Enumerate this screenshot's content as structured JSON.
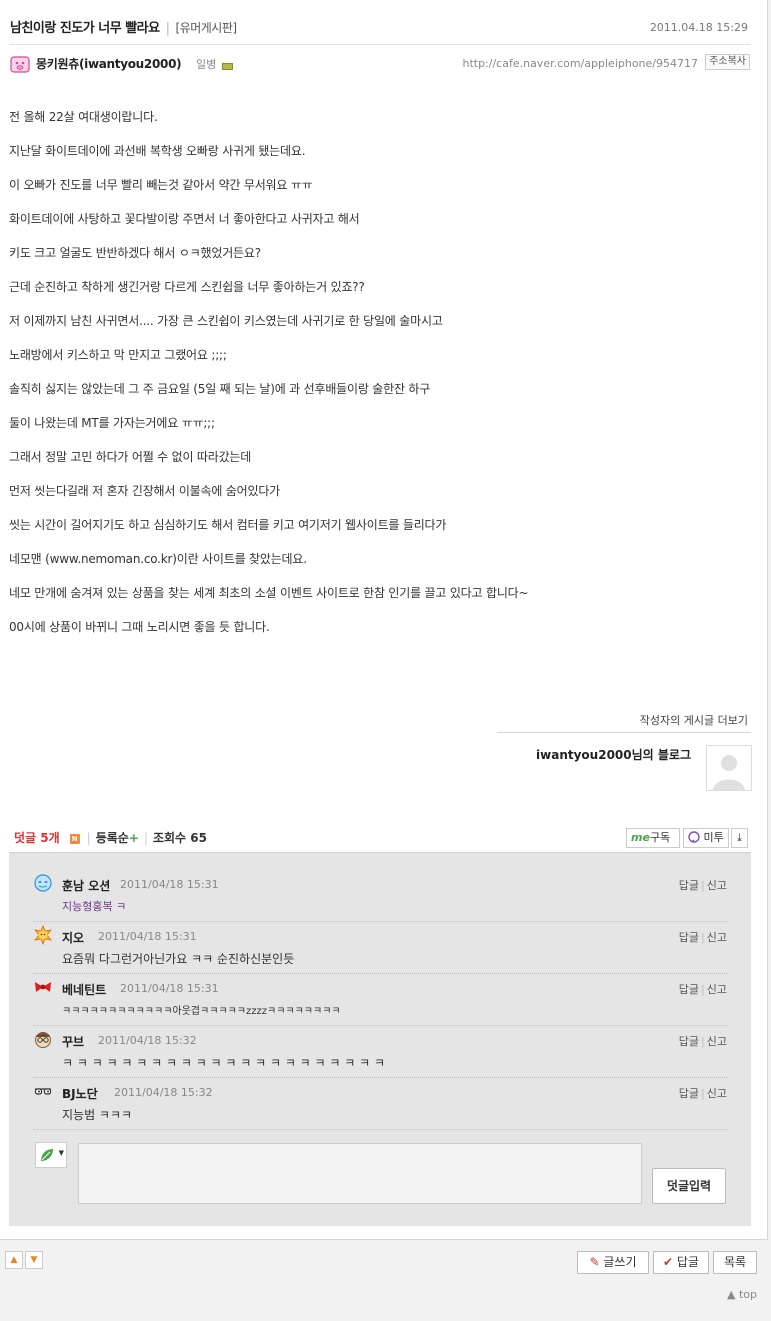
{
  "post": {
    "title": "남친이랑 진도가 너무 빨라요",
    "category": "[유머게시판]",
    "date": "2011.04.18 15:29",
    "author": "몽키원츄(iwantyou2000)",
    "rank": "일병",
    "url": "http://cafe.naver.com/appleiphone/954717",
    "copy_label": "주소복사",
    "body": [
      "전 올해 22살 여대생이랍니다.",
      "지난달 화이트데이에 과선배 복학생 오빠랑 사귀게 됐는데요.",
      "이 오빠가 진도를 너무 빨리 빼는것 같아서 약간 무서워요 ㅠㅠ",
      "화이트데이에 사탕하고 꽃다발이랑 주면서 너 좋아한다고 사귀자고 해서",
      "키도 크고 얼굴도 반반하겠다 해서 ㅇㅋ했었거든요?",
      "근데 순진하고 착하게 생긴거랑 다르게 스킨쉽을 너무 좋아하는거 있죠??",
      "저 이제까지 남친 사귀면서.... 가장 큰 스킨쉽이 키스였는데 사귀기로 한 당일에 술마시고",
      "노래방에서 키스하고 막 만지고 그랬어요 ;;;;",
      "솔직히 싫지는 않았는데 그 주 금요일 (5일 째 되는 날)에 과 선후배들이랑 술한잔 하구",
      "둘이 나왔는데 MT를 가자는거에요 ㅠㅠ;;;",
      "그래서 정말 고민 하다가 어쩔 수 없이 따라갔는데",
      "먼저 씻는다길래 저 혼자 긴장해서 이불속에 숨어있다가",
      "씻는 시간이 길어지기도 하고 심심하기도 해서 컴터를 키고 여기저기 웹사이트를 들리다가",
      "네모맨 (www.nemoman.co.kr)이란 사이트를 찾았는데요.",
      "네모 만개에 숨겨져 있는 상품을 찾는 세계 최초의 소셜 이벤트 사이트로 한참 인기를 끌고 있다고 합니다~",
      "00시에 상품이 바뀌니 그때 노리시면 좋을 듯 합니다."
    ],
    "more_link": "작성자의 게시글 더보기",
    "blog_link": "iwantyou2000님의 블로그"
  },
  "comments_header": {
    "label": "덧글 5개",
    "new_badge": "N",
    "order": "등록순",
    "order_plus": "+",
    "views": "조회수 65",
    "subscribe": "구독",
    "me_logo": "me",
    "metoo": "미투"
  },
  "comments": [
    {
      "name": "훈남 오션",
      "time": "2011/04/18 15:31",
      "text": "지능형홍복 ㅋ",
      "icon": "blue-face-icon"
    },
    {
      "name": "지오",
      "time": "2011/04/18 15:31",
      "text": "요즘뭐 다그런거아닌가요 ㅋㅋ 순진하신분인듯",
      "icon": "sun-face-icon"
    },
    {
      "name": "베네틴트",
      "time": "2011/04/18 15:31",
      "text": "ㅋㅋㅋㅋㅋㅋㅋㅋㅋㅋㅋㅋ아웃겹ㅋㅋㅋㅋㅋzzzzㅋㅋㅋㅋㅋㅋㅋㅋ",
      "icon": "red-ribbon-icon"
    },
    {
      "name": "꾸브",
      "time": "2011/04/18 15:32",
      "text": "ㅋ ㅋ ㅋ ㅋ ㅋ ㅋ ㅋ ㅋ ㅋ ㅋ ㅋ ㅋ ㅋ ㅋ ㅋ ㅋ ㅋ ㅋ ㅋ ㅋ ㅋ ㅋ",
      "icon": "glasses-face-icon"
    },
    {
      "name": "BJ노단",
      "time": "2011/04/18 15:32",
      "text": "지능범 ㅋㅋㅋ",
      "icon": "sunglasses-icon"
    }
  ],
  "comment_actions": {
    "reply": "답글",
    "report": "신고"
  },
  "comment_form": {
    "submit": "덧글입력"
  },
  "footer": {
    "write": "글쓰기",
    "reply": "답글",
    "list": "목록",
    "top": "top"
  },
  "colors": {
    "accent_red": "#dd3333",
    "green": "#4aa54a",
    "orange": "#f08a3e"
  }
}
